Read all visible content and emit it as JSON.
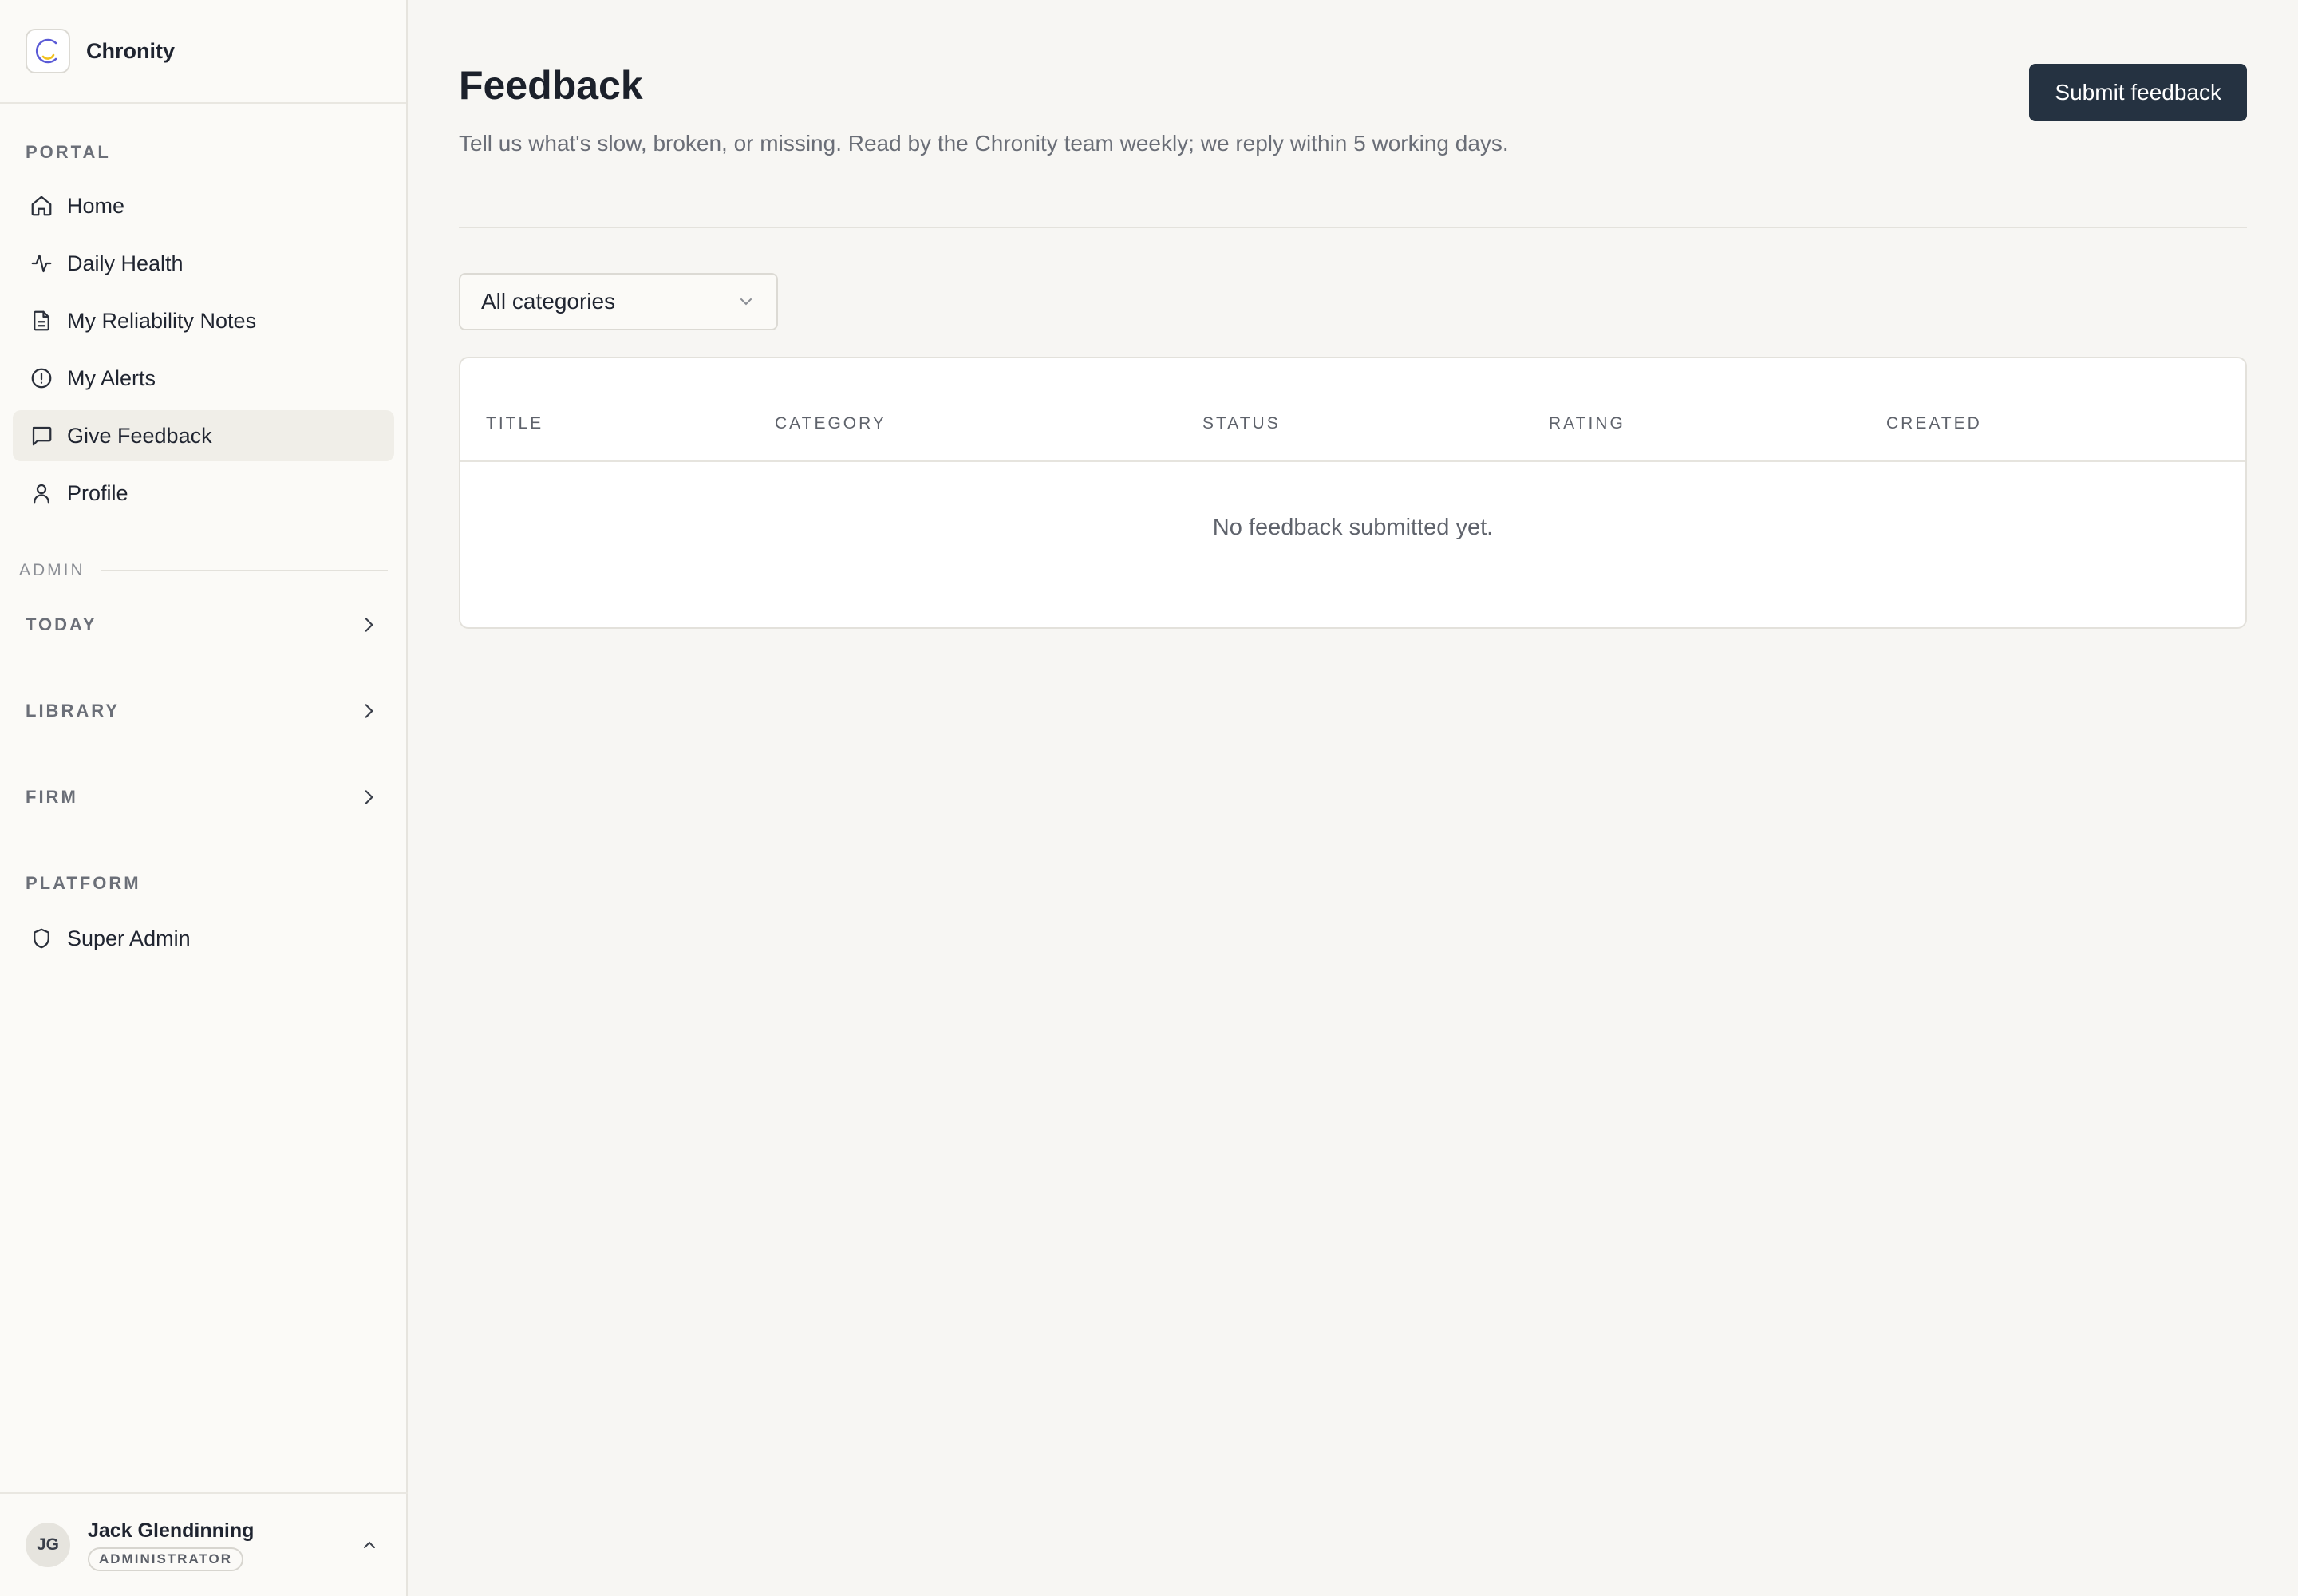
{
  "brand": {
    "name": "Chronity"
  },
  "sidebar": {
    "portal_label": "PORTAL",
    "items": [
      {
        "label": "Home",
        "icon": "home-icon"
      },
      {
        "label": "Daily Health",
        "icon": "activity-icon"
      },
      {
        "label": "My Reliability Notes",
        "icon": "document-icon"
      },
      {
        "label": "My Alerts",
        "icon": "alert-circle-icon"
      },
      {
        "label": "Give Feedback",
        "icon": "message-square-icon",
        "active": true
      },
      {
        "label": "Profile",
        "icon": "user-icon"
      }
    ],
    "admin_label": "ADMIN",
    "groups": [
      {
        "label": "TODAY"
      },
      {
        "label": "LIBRARY"
      },
      {
        "label": "FIRM"
      }
    ],
    "platform_label": "PLATFORM",
    "platform_items": [
      {
        "label": "Super Admin",
        "icon": "shield-icon"
      }
    ]
  },
  "user": {
    "initials": "JG",
    "name": "Jack Glendinning",
    "role": "ADMINISTRATOR"
  },
  "page": {
    "title": "Feedback",
    "description": "Tell us what's slow, broken, or missing. Read by the Chronity team weekly; we reply within 5 working days.",
    "submit_label": "Submit feedback"
  },
  "filter": {
    "selected": "All categories"
  },
  "table": {
    "columns": [
      "TITLE",
      "CATEGORY",
      "STATUS",
      "RATING",
      "CREATED"
    ],
    "empty_message": "No feedback submitted yet."
  },
  "colors": {
    "accent": "#253241",
    "logo_blue": "#5b5bd6",
    "logo_yellow": "#f2c11d"
  }
}
